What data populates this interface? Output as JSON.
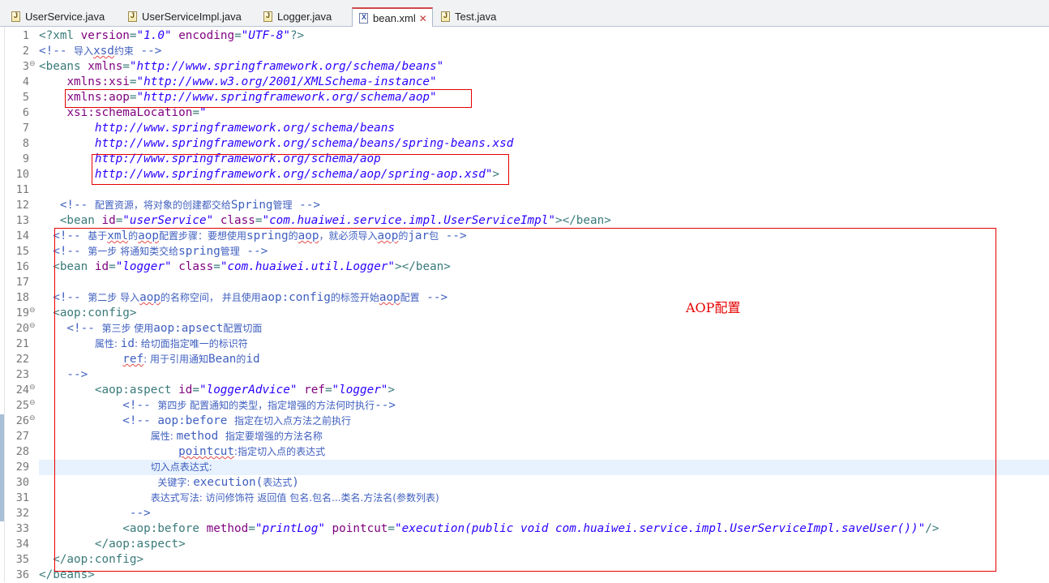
{
  "tabs": [
    {
      "label": "UserService.java",
      "icon": "java-file-icon",
      "active": false
    },
    {
      "label": "UserServiceImpl.java",
      "icon": "java-file-icon",
      "active": false
    },
    {
      "label": "Logger.java",
      "icon": "java-file-icon",
      "active": false
    },
    {
      "label": "bean.xml",
      "icon": "xml-file-icon",
      "active": true
    },
    {
      "label": "Test.java",
      "icon": "java-file-icon",
      "active": false
    }
  ],
  "annotation_label": "AOP配置",
  "colors": {
    "tag": "#3a7a7a",
    "attribute": "#7f007f",
    "value": "#2a00ff",
    "comment": "#3f5fbf",
    "highlight_box": "#e60000",
    "current_line": "#e8f2fe"
  },
  "editor": {
    "current_line": 29,
    "lines": [
      {
        "n": "1",
        "tokens": [
          [
            "t",
            "<?xml "
          ],
          [
            "a",
            "version"
          ],
          [
            "t",
            "="
          ],
          [
            "v",
            "\"1.0\""
          ],
          [
            "t",
            " "
          ],
          [
            "a",
            "encoding"
          ],
          [
            "t",
            "="
          ],
          [
            "v",
            "\"UTF-8\""
          ],
          [
            "t",
            "?>"
          ]
        ]
      },
      {
        "n": "2",
        "tokens": [
          [
            "c",
            "<!-- "
          ],
          [
            "cc",
            "导入"
          ],
          [
            "cs",
            "xsd"
          ],
          [
            "cc",
            "约束"
          ],
          [
            "c",
            " -->"
          ]
        ]
      },
      {
        "n": "3",
        "fold": true,
        "tokens": [
          [
            "t",
            "<beans "
          ],
          [
            "a",
            "xmlns"
          ],
          [
            "t",
            "="
          ],
          [
            "v",
            "\"http://www.springframework.org/schema/beans\""
          ]
        ]
      },
      {
        "n": "4",
        "tokens": [
          [
            "t",
            "    "
          ],
          [
            "a",
            "xmlns:xsi"
          ],
          [
            "t",
            "="
          ],
          [
            "v",
            "\"http://www.w3.org/2001/XMLSchema-instance\""
          ]
        ]
      },
      {
        "n": "5",
        "tokens": [
          [
            "t",
            "    "
          ],
          [
            "a",
            "xmlns:aop"
          ],
          [
            "t",
            "="
          ],
          [
            "v",
            "\"http://www.springframework.org/schema/aop\""
          ]
        ]
      },
      {
        "n": "6",
        "tokens": [
          [
            "t",
            "    "
          ],
          [
            "a",
            "xsi:schemaLocation"
          ],
          [
            "t",
            "="
          ],
          [
            "v",
            "\""
          ]
        ]
      },
      {
        "n": "7",
        "tokens": [
          [
            "v",
            "        http://www.springframework.org/schema/beans"
          ]
        ]
      },
      {
        "n": "8",
        "tokens": [
          [
            "v",
            "        http://www.springframework.org/schema/beans/spring-beans.xsd"
          ]
        ]
      },
      {
        "n": "9",
        "tokens": [
          [
            "v",
            "        http://www.springframework.org/schema/aop"
          ]
        ]
      },
      {
        "n": "10",
        "tokens": [
          [
            "v",
            "        http://www.springframework.org/schema/aop/spring-aop.xsd\""
          ],
          [
            "t",
            ">"
          ]
        ]
      },
      {
        "n": "11",
        "tokens": []
      },
      {
        "n": "12",
        "tokens": [
          [
            "c",
            "   <!-- "
          ],
          [
            "cc",
            "配置资源，将对象的创建都交给"
          ],
          [
            "c",
            "Spring"
          ],
          [
            "cc",
            "管理"
          ],
          [
            "c",
            " -->"
          ]
        ]
      },
      {
        "n": "13",
        "tokens": [
          [
            "t",
            "   <bean "
          ],
          [
            "a",
            "id"
          ],
          [
            "t",
            "="
          ],
          [
            "v",
            "\"userService\""
          ],
          [
            "t",
            " "
          ],
          [
            "a",
            "class"
          ],
          [
            "t",
            "="
          ],
          [
            "v",
            "\"com.huaiwei.service.impl.UserServiceImpl\""
          ],
          [
            "t",
            "></bean>"
          ]
        ]
      },
      {
        "n": "14",
        "tokens": [
          [
            "c",
            "  <!-- "
          ],
          [
            "cc",
            "基于"
          ],
          [
            "cs",
            "xml"
          ],
          [
            "cc",
            "的"
          ],
          [
            "cs",
            "aop"
          ],
          [
            "cc",
            "配置步骤：要想使用"
          ],
          [
            "c",
            "spring"
          ],
          [
            "cc",
            "的"
          ],
          [
            "cs",
            "aop"
          ],
          [
            "cc",
            "，就必须导入"
          ],
          [
            "cs",
            "aop"
          ],
          [
            "cc",
            "的"
          ],
          [
            "c",
            "jar"
          ],
          [
            "cc",
            "包"
          ],
          [
            "c",
            " -->"
          ]
        ]
      },
      {
        "n": "15",
        "tokens": [
          [
            "c",
            "  <!-- "
          ],
          [
            "cc",
            "第一步 将通知类交给"
          ],
          [
            "c",
            "spring"
          ],
          [
            "cc",
            "管理"
          ],
          [
            "c",
            " -->"
          ]
        ]
      },
      {
        "n": "16",
        "tokens": [
          [
            "t",
            "  <bean "
          ],
          [
            "a",
            "id"
          ],
          [
            "t",
            "="
          ],
          [
            "v",
            "\"logger\""
          ],
          [
            "t",
            " "
          ],
          [
            "a",
            "class"
          ],
          [
            "t",
            "="
          ],
          [
            "v",
            "\"com.huaiwei.util.Logger\""
          ],
          [
            "t",
            "></bean>"
          ]
        ]
      },
      {
        "n": "17",
        "tokens": []
      },
      {
        "n": "18",
        "tokens": [
          [
            "c",
            "  <!-- "
          ],
          [
            "cc",
            "第二步 导入"
          ],
          [
            "cs",
            "aop"
          ],
          [
            "cc",
            "的名称空间， 并且使用"
          ],
          [
            "c",
            "aop:config"
          ],
          [
            "cc",
            "的标签开始"
          ],
          [
            "cs",
            "aop"
          ],
          [
            "cc",
            "配置"
          ],
          [
            "c",
            " -->"
          ]
        ]
      },
      {
        "n": "19",
        "fold": true,
        "tokens": [
          [
            "t",
            "  <aop:config>"
          ]
        ]
      },
      {
        "n": "20",
        "fold": true,
        "tokens": [
          [
            "c",
            "    <!-- "
          ],
          [
            "cc",
            "第三步 使用"
          ],
          [
            "c",
            "aop:apsect"
          ],
          [
            "cc",
            "配置切面"
          ]
        ]
      },
      {
        "n": "21",
        "tokens": [
          [
            "c",
            "        "
          ],
          [
            "cc",
            "属性: "
          ],
          [
            "c",
            "id"
          ],
          [
            "cc",
            ": 给切面指定唯一的标识符"
          ]
        ]
      },
      {
        "n": "22",
        "tokens": [
          [
            "c",
            "            "
          ],
          [
            "cs",
            "ref"
          ],
          [
            "cc",
            ": 用于引用通知"
          ],
          [
            "c",
            "Bean"
          ],
          [
            "cc",
            "的"
          ],
          [
            "c",
            "id"
          ]
        ]
      },
      {
        "n": "23",
        "tokens": [
          [
            "c",
            "    -->"
          ]
        ]
      },
      {
        "n": "24",
        "fold": true,
        "tokens": [
          [
            "t",
            "        <aop:aspect "
          ],
          [
            "a",
            "id"
          ],
          [
            "t",
            "="
          ],
          [
            "v",
            "\"loggerAdvice\""
          ],
          [
            "t",
            " "
          ],
          [
            "a",
            "ref"
          ],
          [
            "t",
            "="
          ],
          [
            "v",
            "\"logger\""
          ],
          [
            "t",
            ">"
          ]
        ]
      },
      {
        "n": "25",
        "fold": true,
        "tokens": [
          [
            "c",
            "            <!-- "
          ],
          [
            "cc",
            "第四步 配置通知的类型，指定增强的方法何时执行"
          ],
          [
            "c",
            "-->"
          ]
        ]
      },
      {
        "n": "26",
        "fold": true,
        "tokens": [
          [
            "c",
            "            <!-- aop:before "
          ],
          [
            "cc",
            "指定在切入点方法之前执行"
          ]
        ]
      },
      {
        "n": "27",
        "tokens": [
          [
            "c",
            "                "
          ],
          [
            "cc",
            "属性: "
          ],
          [
            "c",
            "method "
          ],
          [
            "cc",
            "指定要增强的方法名称"
          ]
        ]
      },
      {
        "n": "28",
        "tokens": [
          [
            "c",
            "                    "
          ],
          [
            "cs",
            "pointcut"
          ],
          [
            "cc",
            ":指定切入点的表达式"
          ]
        ]
      },
      {
        "n": "29",
        "tokens": [
          [
            "c",
            "                "
          ],
          [
            "cc",
            "切入点表达式:"
          ]
        ]
      },
      {
        "n": "30",
        "tokens": [
          [
            "c",
            "                 "
          ],
          [
            "cc",
            "关键字: "
          ],
          [
            "c",
            "execution("
          ],
          [
            "cc",
            "表达式"
          ],
          [
            "c",
            ")"
          ]
        ]
      },
      {
        "n": "31",
        "tokens": [
          [
            "c",
            "                "
          ],
          [
            "cc",
            "表达式写法: 访问修饰符 返回值 包名.包名...类名.方法名(参数列表)"
          ]
        ]
      },
      {
        "n": "32",
        "tokens": [
          [
            "c",
            "             -->"
          ]
        ]
      },
      {
        "n": "33",
        "tokens": [
          [
            "t",
            "            <aop:before "
          ],
          [
            "a",
            "method"
          ],
          [
            "t",
            "="
          ],
          [
            "v",
            "\"printLog\""
          ],
          [
            "t",
            " "
          ],
          [
            "a",
            "pointcut"
          ],
          [
            "t",
            "="
          ],
          [
            "v",
            "\"execution(public void com.huaiwei.service.impl.UserServiceImpl.saveUser())\""
          ],
          [
            "t",
            "/>"
          ]
        ]
      },
      {
        "n": "34",
        "tokens": [
          [
            "t",
            "        </aop:aspect>"
          ]
        ]
      },
      {
        "n": "35",
        "tokens": [
          [
            "t",
            "  </aop:config>"
          ]
        ]
      },
      {
        "n": "36",
        "tokens": [
          [
            "t",
            "</beans>"
          ]
        ]
      }
    ]
  }
}
